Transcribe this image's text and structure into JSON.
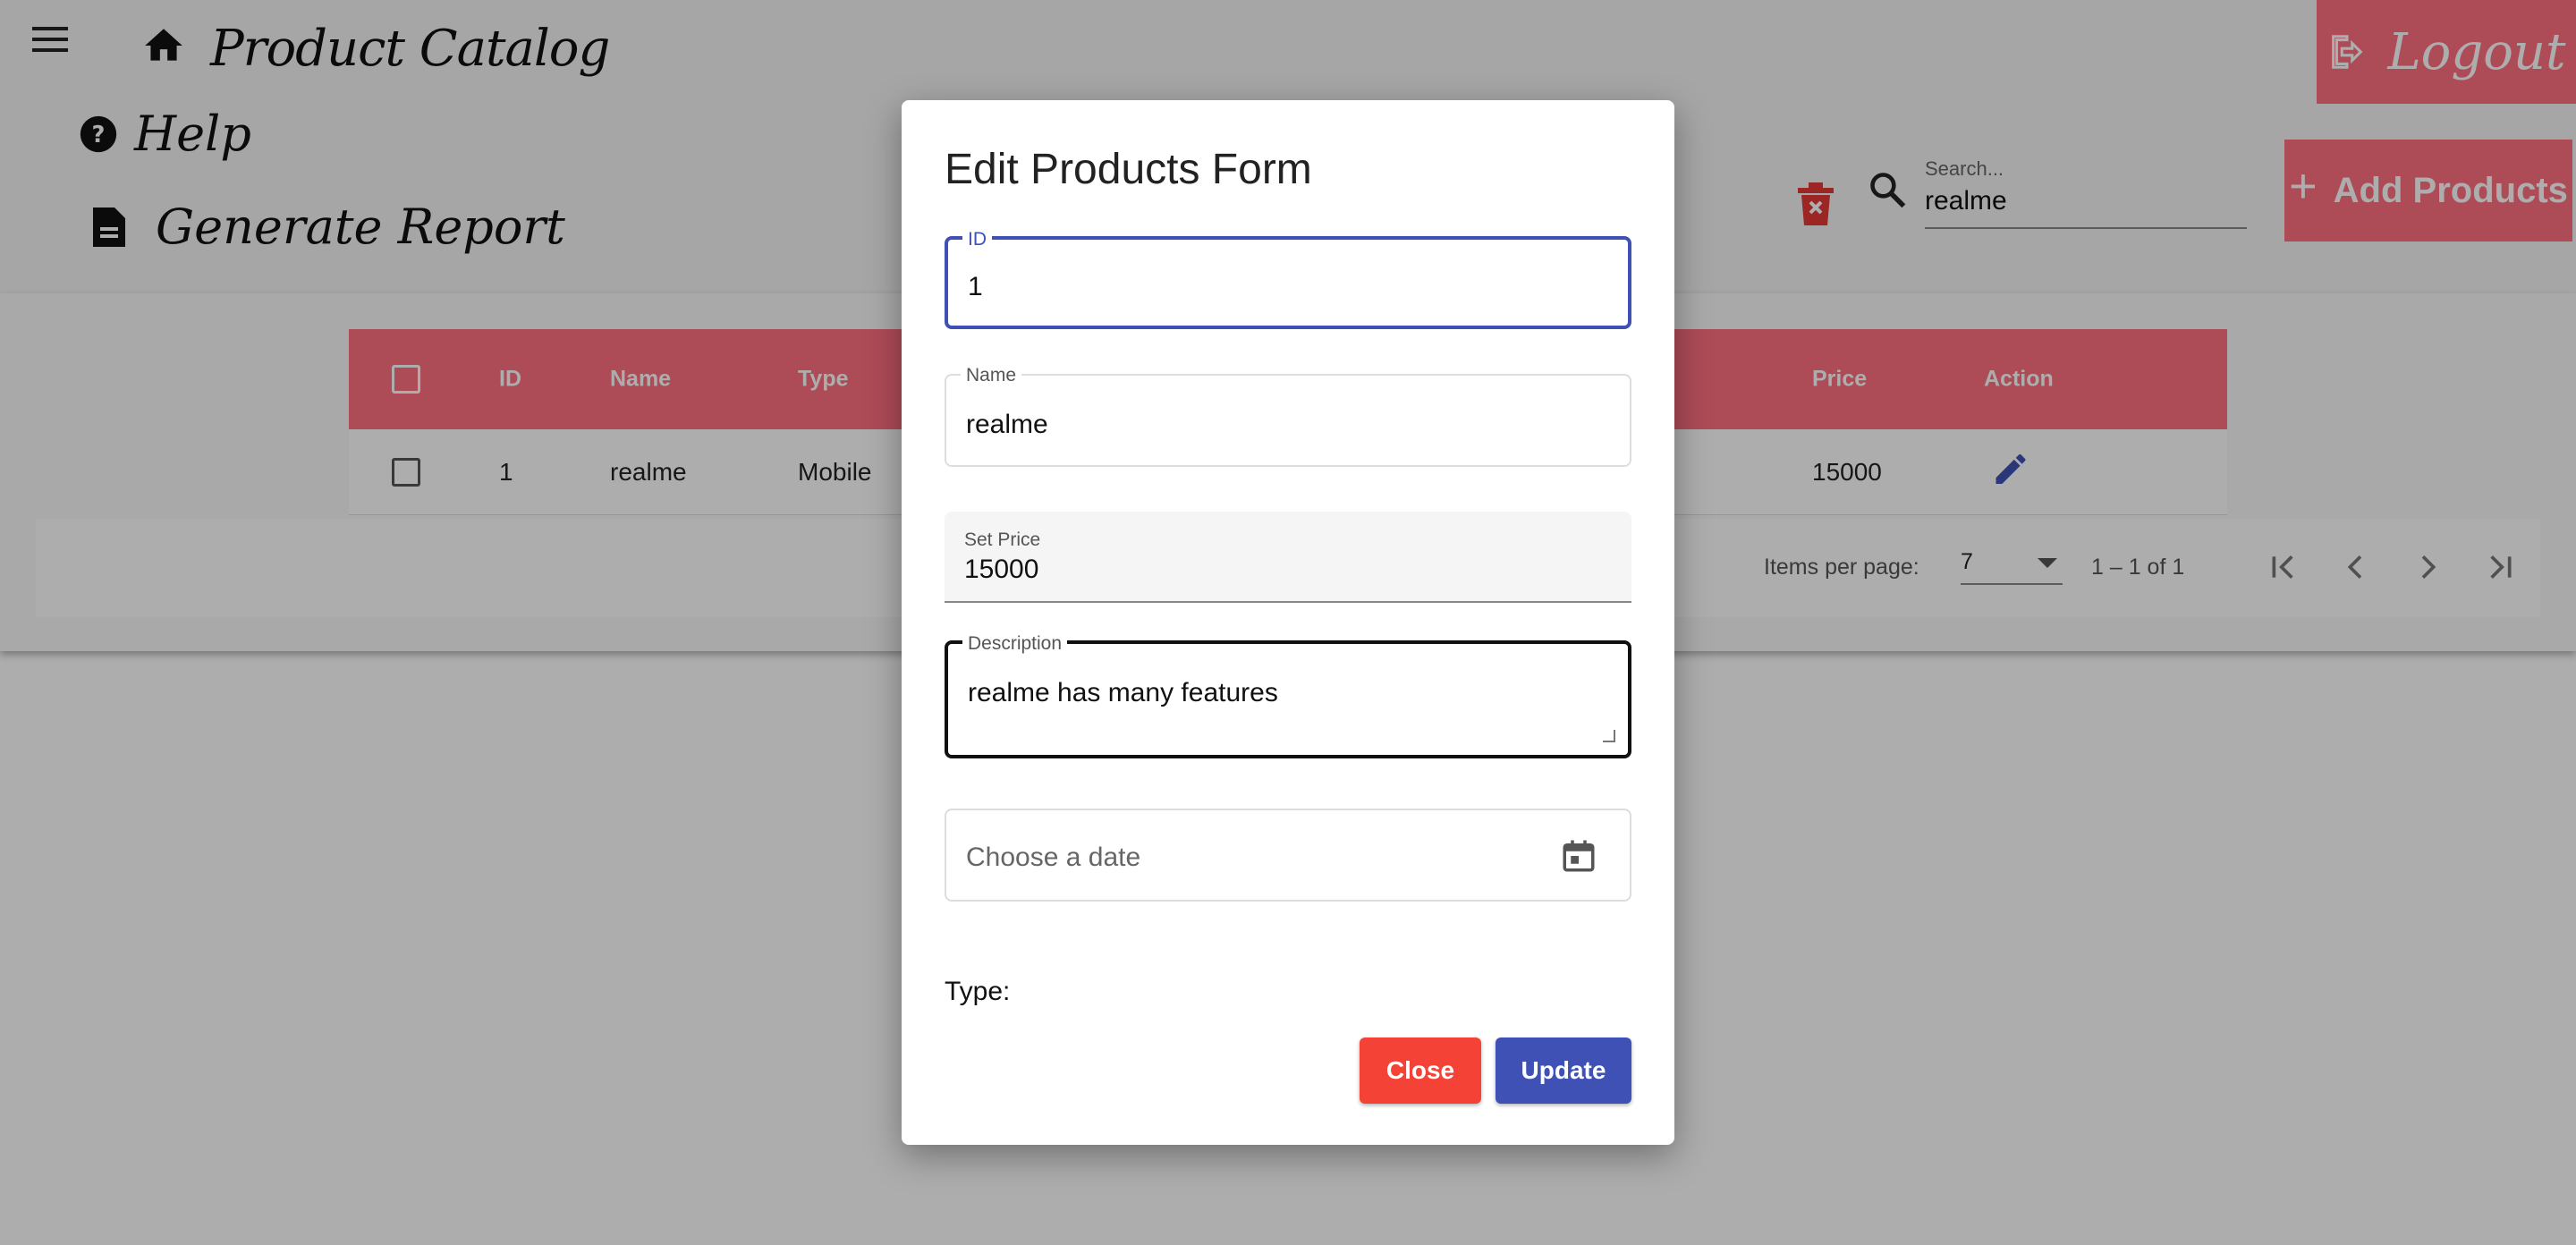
{
  "header": {
    "title": "Product Catalog",
    "logout_label": "Logout"
  },
  "nav": {
    "help_label": "Help",
    "report_label": "Generate Report"
  },
  "toolbar": {
    "search_label": "Search...",
    "search_value": "realme",
    "add_label": "Add Products"
  },
  "table": {
    "columns": [
      "ID",
      "Name",
      "Type",
      "Price",
      "Action"
    ],
    "rows": [
      {
        "id": "1",
        "name": "realme",
        "type": "Mobile",
        "price": "15000"
      }
    ]
  },
  "paginator": {
    "items_per_page_label": "Items per page:",
    "page_size": "7",
    "range": "1 – 1 of 1"
  },
  "dialog": {
    "title": "Edit Products Form",
    "id_label": "ID",
    "id_value": "1",
    "name_label": "Name",
    "name_value": "realme",
    "price_label": "Set Price",
    "price_value": "15000",
    "description_label": "Description",
    "description_value": "realme has many features",
    "date_placeholder": "Choose a date",
    "type_label": "Type:",
    "close_label": "Close",
    "update_label": "Update"
  },
  "colors": {
    "accent": "#ff6f80",
    "primary": "#3f51b5",
    "warn": "#f44336"
  }
}
